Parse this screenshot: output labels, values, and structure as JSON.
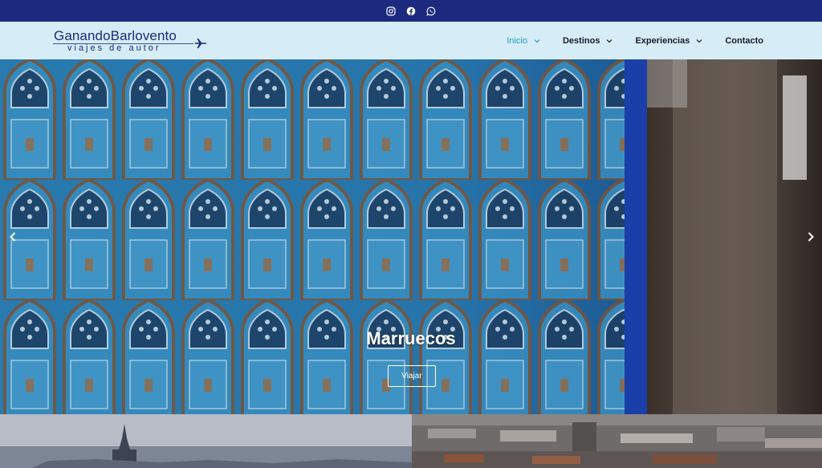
{
  "topbar": {
    "background": "#1b2a7e",
    "icons": [
      "instagram-icon",
      "facebook-icon",
      "whatsapp-icon"
    ]
  },
  "header": {
    "logo": {
      "main": "GanandoBarlovento",
      "sub": "viajes de autor"
    },
    "nav": [
      {
        "label": "Inicio",
        "active": true,
        "has_dropdown": true
      },
      {
        "label": "Destinos",
        "active": false,
        "has_dropdown": true
      },
      {
        "label": "Experiencias",
        "active": false,
        "has_dropdown": true
      },
      {
        "label": "Contacto",
        "active": false,
        "has_dropdown": false
      }
    ],
    "accent": "#1e9cc6"
  },
  "hero": {
    "title": "Marruecos",
    "button": "Viajar",
    "prev_icon": "chevron-left-icon",
    "next_icon": "chevron-right-icon"
  },
  "tiles": [
    {
      "image": "city-cathedral-photo"
    },
    {
      "image": "city-rooftops-photo"
    }
  ]
}
